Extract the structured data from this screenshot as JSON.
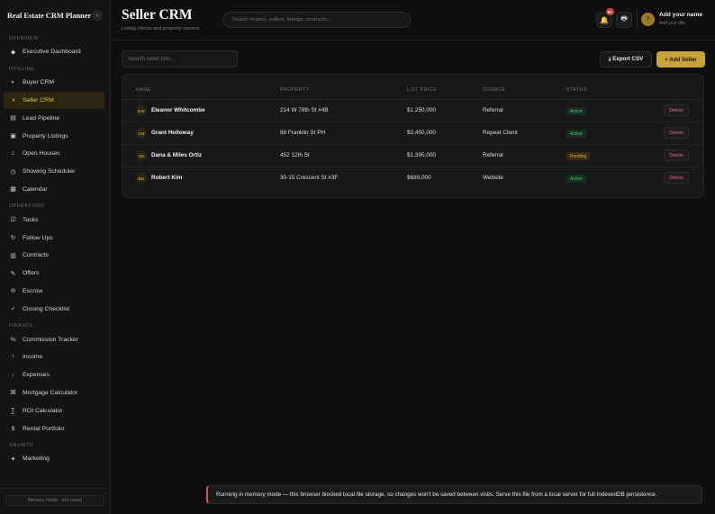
{
  "sidebar": {
    "brand": "Real Estate CRM Planner",
    "collapse_icon": "‹",
    "sections": {
      "overview": "OVERVIEW",
      "pipeline": "PIPELINE",
      "operations": "OPERATIONS",
      "finance": "FINANCE",
      "growth": "GROWTH"
    },
    "items": {
      "executive_dashboard": "Executive Dashboard",
      "buyer_crm": "Buyer CRM",
      "seller_crm": "Seller CRM",
      "lead_pipeline": "Lead Pipeline",
      "property_listings": "Property Listings",
      "open_houses": "Open Houses",
      "showing_scheduler": "Showing Scheduler",
      "calendar": "Calendar",
      "tasks": "Tasks",
      "follow_ups": "Follow Ups",
      "contracts": "Contracts",
      "offers": "Offers",
      "escrow": "Escrow",
      "closing_checklist": "Closing Checklist",
      "commission_tracker": "Commission Tracker",
      "income": "Income",
      "expenses": "Expenses",
      "mortgage_calculator": "Mortgage Calculator",
      "roi_calculator": "ROI Calculator",
      "rental_portfolio": "Rental Portfolio",
      "marketing": "Marketing"
    },
    "active_item": "seller_crm",
    "memory_note": "Memory mode · not saved"
  },
  "header": {
    "title": "Seller CRM",
    "subtitle": "Listing clients and property owners",
    "search_placeholder": "Search buyers, sellers, listings, contracts...",
    "notification_count": "9+",
    "user_initial": "?",
    "user_name": "Add your name",
    "user_site": "Add your title"
  },
  "toolbar": {
    "search_placeholder": "Search seller crm...",
    "export_label": "⤓ Export CSV",
    "add_label": "+ Add Seller"
  },
  "table": {
    "columns": {
      "name": "NAME",
      "property": "PROPERTY",
      "list_price": "LIST PRICE",
      "source": "SOURCE",
      "status": "STATUS"
    },
    "delete_label": "Delete",
    "rows": [
      {
        "initials": "EW",
        "name": "Eleanor Whitcombe",
        "property": "214 W 78th St #4B",
        "price": "$1,250,000",
        "source": "Referral",
        "status": "Active"
      },
      {
        "initials": "GH",
        "name": "Grant Holloway",
        "property": "88 Franklin St PH",
        "price": "$3,450,000",
        "source": "Repeat Client",
        "status": "Active"
      },
      {
        "initials": "DS",
        "name": "Dana & Miles Ortiz",
        "property": "452 12th St",
        "price": "$1,395,000",
        "source": "Referral",
        "status": "Pending"
      },
      {
        "initials": "RK",
        "name": "Robert Kim",
        "property": "30-15 Crescent St #3F",
        "price": "$689,000",
        "source": "Website",
        "status": "Active"
      }
    ]
  },
  "toast": {
    "message": "Running in memory mode — this browser blocked local file storage, so changes won't be saved between visits. Serve this file from a local server for full IndexedDB persistence."
  },
  "colors": {
    "accent": "#c9a23a",
    "active_status": "#56c27a",
    "pending_status": "#e0a44a",
    "danger": "#e07070",
    "background": "#0f0f11"
  }
}
